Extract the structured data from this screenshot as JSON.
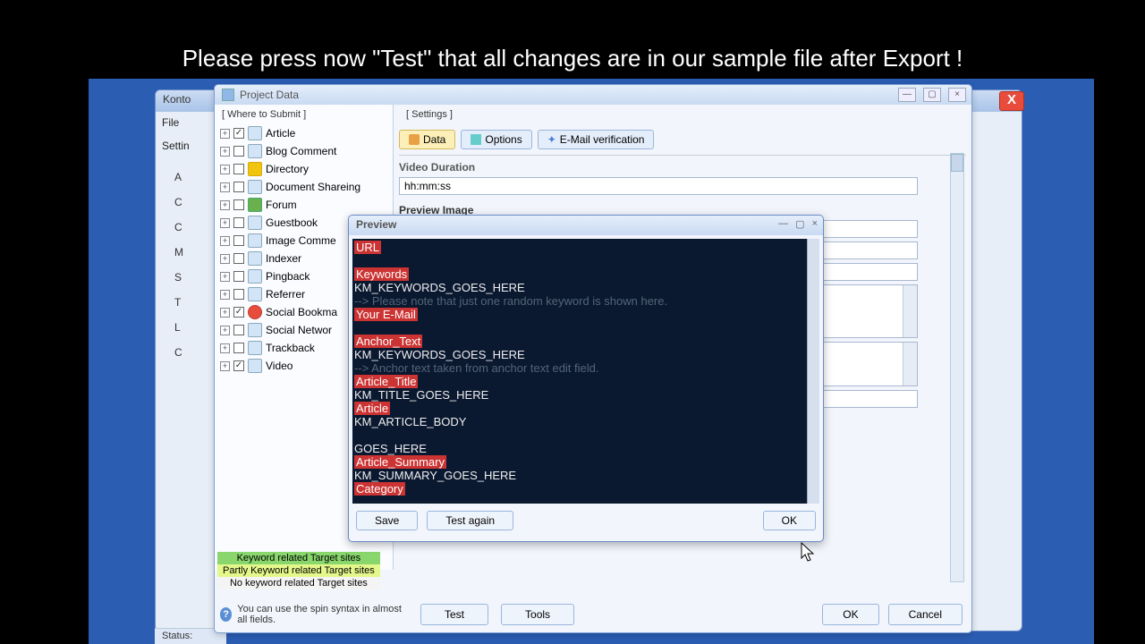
{
  "banner": "Please press now \"Test\" that all changes are in our sample file after Export !",
  "back_window": {
    "title": "Konto",
    "menu_file": "File",
    "tab_settings": "Settin",
    "left_labels": [
      "A",
      "",
      "C",
      "",
      "C",
      "M",
      "S",
      "T",
      "",
      "L",
      "",
      "C"
    ]
  },
  "project_window": {
    "title": "Project Data",
    "where_to_submit": "[ Where to Submit ]",
    "settings_label": "[ Settings ]",
    "tabs": {
      "data": "Data",
      "options": "Options",
      "email": "E-Mail verification"
    },
    "fields": {
      "video_duration": "Video Duration",
      "video_duration_val": "hh:mm:ss",
      "preview_image": "Preview Image"
    },
    "tree": [
      {
        "label": "Article",
        "checked": true,
        "icon": ""
      },
      {
        "label": "Blog Comment",
        "checked": false,
        "icon": ""
      },
      {
        "label": "Directory",
        "checked": false,
        "icon": "yel"
      },
      {
        "label": "Document Shareing",
        "checked": false,
        "icon": ""
      },
      {
        "label": "Forum",
        "checked": false,
        "icon": "grn"
      },
      {
        "label": "Guestbook",
        "checked": false,
        "icon": ""
      },
      {
        "label": "Image Comme",
        "checked": false,
        "icon": ""
      },
      {
        "label": "Indexer",
        "checked": false,
        "icon": ""
      },
      {
        "label": "Pingback",
        "checked": false,
        "icon": ""
      },
      {
        "label": "Referrer",
        "checked": false,
        "icon": ""
      },
      {
        "label": "Social Bookma",
        "checked": true,
        "icon": "red"
      },
      {
        "label": "Social Networ",
        "checked": false,
        "icon": ""
      },
      {
        "label": "Trackback",
        "checked": false,
        "icon": ""
      },
      {
        "label": "Video",
        "checked": true,
        "icon": ""
      }
    ],
    "legend": {
      "l1": "Keyword related Target sites",
      "l2": "Partly Keyword related Target sites",
      "l3": "No keyword related Target sites"
    },
    "tip": "You can use the spin syntax in almost all fields.",
    "buttons": {
      "test": "Test",
      "tools": "Tools",
      "ok": "OK",
      "cancel": "Cancel"
    }
  },
  "preview_window": {
    "title": "Preview",
    "lines": [
      {
        "t": "h",
        "v": "URL"
      },
      {
        "t": "b",
        "v": ""
      },
      {
        "t": "h",
        "v": "Keywords"
      },
      {
        "t": "m",
        "v": "KM_KEYWORDS_GOES_HERE"
      },
      {
        "t": "c",
        "v": "  --> Please note that just one random keyword is shown here."
      },
      {
        "t": "h",
        "v": "Your E-Mail"
      },
      {
        "t": "b",
        "v": ""
      },
      {
        "t": "h",
        "v": "Anchor_Text"
      },
      {
        "t": "m",
        "v": "KM_KEYWORDS_GOES_HERE"
      },
      {
        "t": "c",
        "v": "  --> Anchor text taken from anchor text edit field."
      },
      {
        "t": "h",
        "v": "Article_Title"
      },
      {
        "t": "m",
        "v": "KM_TITLE_GOES_HERE"
      },
      {
        "t": "h",
        "v": "Article"
      },
      {
        "t": "m",
        "v": "KM_ARTICLE_BODY"
      },
      {
        "t": "b",
        "v": ""
      },
      {
        "t": "m",
        "v": "GOES_HERE"
      },
      {
        "t": "h",
        "v": "Article_Summary"
      },
      {
        "t": "m",
        "v": "KM_SUMMARY_GOES_HERE"
      },
      {
        "t": "h",
        "v": "Category"
      }
    ],
    "buttons": {
      "save": "Save",
      "test_again": "Test again",
      "ok": "OK"
    }
  },
  "status": "Status:"
}
